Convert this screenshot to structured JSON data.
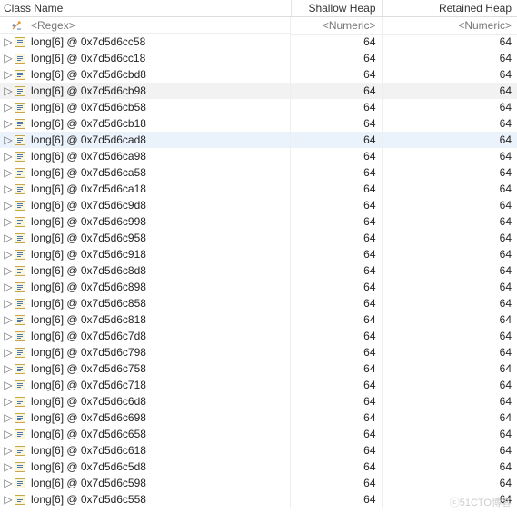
{
  "columns": {
    "name": "Class Name",
    "shallow": "Shallow Heap",
    "retained": "Retained Heap"
  },
  "filter": {
    "regex": "<Regex>",
    "numeric": "<Numeric>"
  },
  "rows": [
    {
      "label": "long[6] @ 0x7d5d6cc58",
      "sh": "64",
      "rh": "64",
      "hl": ""
    },
    {
      "label": "long[6] @ 0x7d5d6cc18",
      "sh": "64",
      "rh": "64",
      "hl": ""
    },
    {
      "label": "long[6] @ 0x7d5d6cbd8",
      "sh": "64",
      "rh": "64",
      "hl": ""
    },
    {
      "label": "long[6] @ 0x7d5d6cb98",
      "sh": "64",
      "rh": "64",
      "hl": "highlight"
    },
    {
      "label": "long[6] @ 0x7d5d6cb58",
      "sh": "64",
      "rh": "64",
      "hl": ""
    },
    {
      "label": "long[6] @ 0x7d5d6cb18",
      "sh": "64",
      "rh": "64",
      "hl": ""
    },
    {
      "label": "long[6] @ 0x7d5d6cad8",
      "sh": "64",
      "rh": "64",
      "hl": "highlight-sel"
    },
    {
      "label": "long[6] @ 0x7d5d6ca98",
      "sh": "64",
      "rh": "64",
      "hl": ""
    },
    {
      "label": "long[6] @ 0x7d5d6ca58",
      "sh": "64",
      "rh": "64",
      "hl": ""
    },
    {
      "label": "long[6] @ 0x7d5d6ca18",
      "sh": "64",
      "rh": "64",
      "hl": ""
    },
    {
      "label": "long[6] @ 0x7d5d6c9d8",
      "sh": "64",
      "rh": "64",
      "hl": ""
    },
    {
      "label": "long[6] @ 0x7d5d6c998",
      "sh": "64",
      "rh": "64",
      "hl": ""
    },
    {
      "label": "long[6] @ 0x7d5d6c958",
      "sh": "64",
      "rh": "64",
      "hl": ""
    },
    {
      "label": "long[6] @ 0x7d5d6c918",
      "sh": "64",
      "rh": "64",
      "hl": ""
    },
    {
      "label": "long[6] @ 0x7d5d6c8d8",
      "sh": "64",
      "rh": "64",
      "hl": ""
    },
    {
      "label": "long[6] @ 0x7d5d6c898",
      "sh": "64",
      "rh": "64",
      "hl": ""
    },
    {
      "label": "long[6] @ 0x7d5d6c858",
      "sh": "64",
      "rh": "64",
      "hl": ""
    },
    {
      "label": "long[6] @ 0x7d5d6c818",
      "sh": "64",
      "rh": "64",
      "hl": ""
    },
    {
      "label": "long[6] @ 0x7d5d6c7d8",
      "sh": "64",
      "rh": "64",
      "hl": ""
    },
    {
      "label": "long[6] @ 0x7d5d6c798",
      "sh": "64",
      "rh": "64",
      "hl": ""
    },
    {
      "label": "long[6] @ 0x7d5d6c758",
      "sh": "64",
      "rh": "64",
      "hl": ""
    },
    {
      "label": "long[6] @ 0x7d5d6c718",
      "sh": "64",
      "rh": "64",
      "hl": ""
    },
    {
      "label": "long[6] @ 0x7d5d6c6d8",
      "sh": "64",
      "rh": "64",
      "hl": ""
    },
    {
      "label": "long[6] @ 0x7d5d6c698",
      "sh": "64",
      "rh": "64",
      "hl": ""
    },
    {
      "label": "long[6] @ 0x7d5d6c658",
      "sh": "64",
      "rh": "64",
      "hl": ""
    },
    {
      "label": "long[6] @ 0x7d5d6c618",
      "sh": "64",
      "rh": "64",
      "hl": ""
    },
    {
      "label": "long[6] @ 0x7d5d6c5d8",
      "sh": "64",
      "rh": "64",
      "hl": ""
    },
    {
      "label": "long[6] @ 0x7d5d6c598",
      "sh": "64",
      "rh": "64",
      "hl": ""
    },
    {
      "label": "long[6] @ 0x7d5d6c558",
      "sh": "64",
      "rh": "64",
      "hl": ""
    }
  ],
  "watermark": "ⓒ51CTO博客"
}
